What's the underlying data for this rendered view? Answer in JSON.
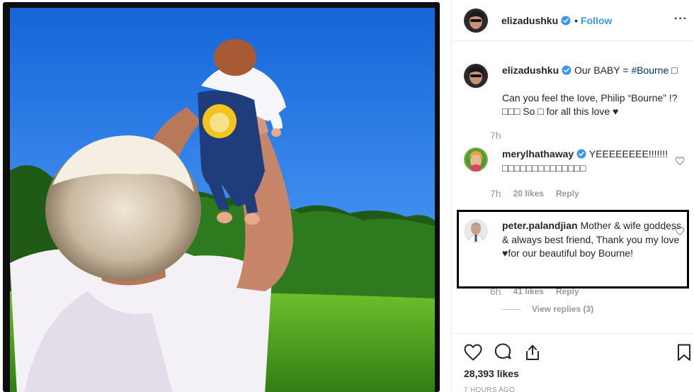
{
  "post": {
    "username": "elizadushku",
    "follow_label": "Follow",
    "separator": "•",
    "more_label": "···"
  },
  "caption": {
    "username": "elizadushku",
    "text_prefix": " Our BABY = ",
    "hashtag": "#Bourne",
    "text_suffix": " □",
    "line2": "Can you feel the love, Philip “Bourne” !? □□□ So □ for all this love ♥",
    "time": "7h"
  },
  "comments": [
    {
      "username": "merylhathaway",
      "text": " YEEEEEEEE!!!!!!! □□□□□□□□□□□□□□",
      "time": "7h",
      "likes": "20 likes",
      "reply_label": "Reply"
    },
    {
      "username": "peter.palandjian",
      "text": " Mother & wife goddess & always best friend, Thank you my love ♥for our beautiful boy Bourne!",
      "time": "6h",
      "likes": "41 likes",
      "reply_label": "Reply",
      "more_label": "···",
      "view_replies": "View replies (3)"
    }
  ],
  "actions": {
    "likes_count": "28,393 likes",
    "timestamp": "7 HOURS AGO"
  },
  "colors": {
    "accent": "#3897f0",
    "hashtag": "#003569",
    "muted": "#999999",
    "highlight_border": "#000000"
  },
  "icons": [
    "verified-badge-icon",
    "heart-icon",
    "comment-icon",
    "share-icon",
    "bookmark-icon",
    "more-options-icon"
  ]
}
